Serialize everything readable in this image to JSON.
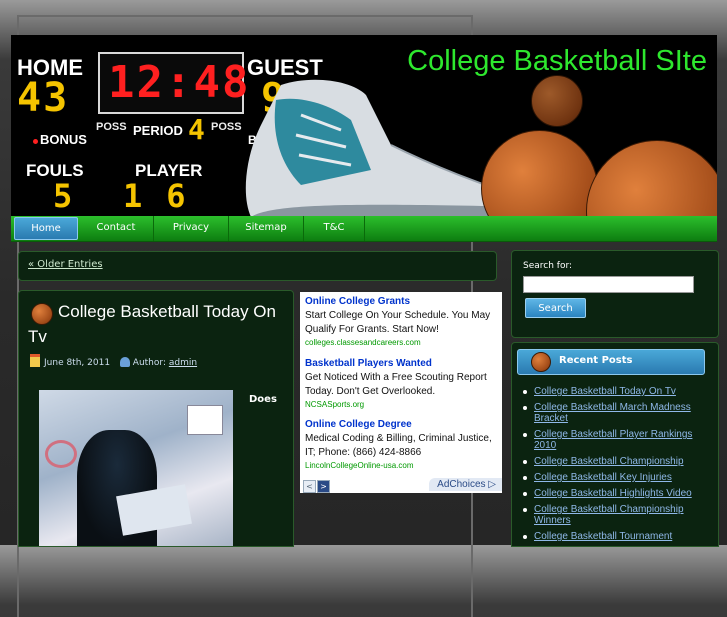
{
  "site": {
    "title": "College Basketball SIte"
  },
  "scoreboard": {
    "home_label": "HOME",
    "guest_label": "GUEST",
    "home_score": "43",
    "guest_score": "99",
    "clock": "12:48",
    "poss_label": "POSS",
    "period_label": "PERIOD",
    "period_value": "4",
    "bonus_label": "BONUS",
    "fouls_label": "FOULS",
    "fouls_value": "5",
    "player_label": "PLAYER",
    "player_value": "16",
    "guest_poss_label": "POSS",
    "guest_bonus_label": "B"
  },
  "nav": {
    "items": [
      {
        "label": "Home"
      },
      {
        "label": "Contact"
      },
      {
        "label": "Privacy"
      },
      {
        "label": "Sitemap"
      },
      {
        "label": "T&C"
      }
    ]
  },
  "pagination": {
    "older_label": "« Older Entries"
  },
  "post": {
    "title": "College Basketball Today On Tv",
    "date": "June 8th, 2011",
    "author_prefix": "Author:",
    "author": "admin",
    "excerpt_start": "Does"
  },
  "ads": {
    "items": [
      {
        "title": "Online College Grants",
        "text": "Start College On Your Schedule. You May Qualify For Grants. Start Now!",
        "url": "colleges.classesandcareers.com"
      },
      {
        "title": "Basketball Players Wanted",
        "text": "Get Noticed With a Free Scouting Report Today. Don't Get Overlooked.",
        "url": "NCSASports.org"
      },
      {
        "title": "Online College Degree",
        "text": "Medical Coding & Billing, Criminal Justice, IT; Phone: (866) 424-8866",
        "url": "LincolnCollegeOnline-usa.com"
      }
    ],
    "adchoices_label": "AdChoices",
    "prev_arrow": "<",
    "next_arrow": ">"
  },
  "search": {
    "label": "Search for:",
    "value": "",
    "button_label": "Search"
  },
  "recent_posts": {
    "title": "Recent Posts",
    "items": [
      "College Basketball Today On Tv",
      "College Basketball March Madness Bracket",
      "College Basketball Player Rankings 2010",
      "College Basketball Championship",
      "College Basketball Key Injuries",
      "College Basketball Highlights Video",
      "College Basketball Championship Winners",
      "College Basketball Tournament"
    ]
  },
  "colors": {
    "title_green": "#2ee82e",
    "nav_green": "#1aa01e",
    "digit_red": "#ff2020",
    "digit_yellow": "#f5c400",
    "link_blue": "#8fb8e8",
    "ad_blue": "#0033cc",
    "ad_green": "#009900"
  },
  "icons": {
    "date": "calendar-icon",
    "author": "user-icon",
    "post_ball": "basketball-icon",
    "recent_ball": "basketball-icon"
  }
}
